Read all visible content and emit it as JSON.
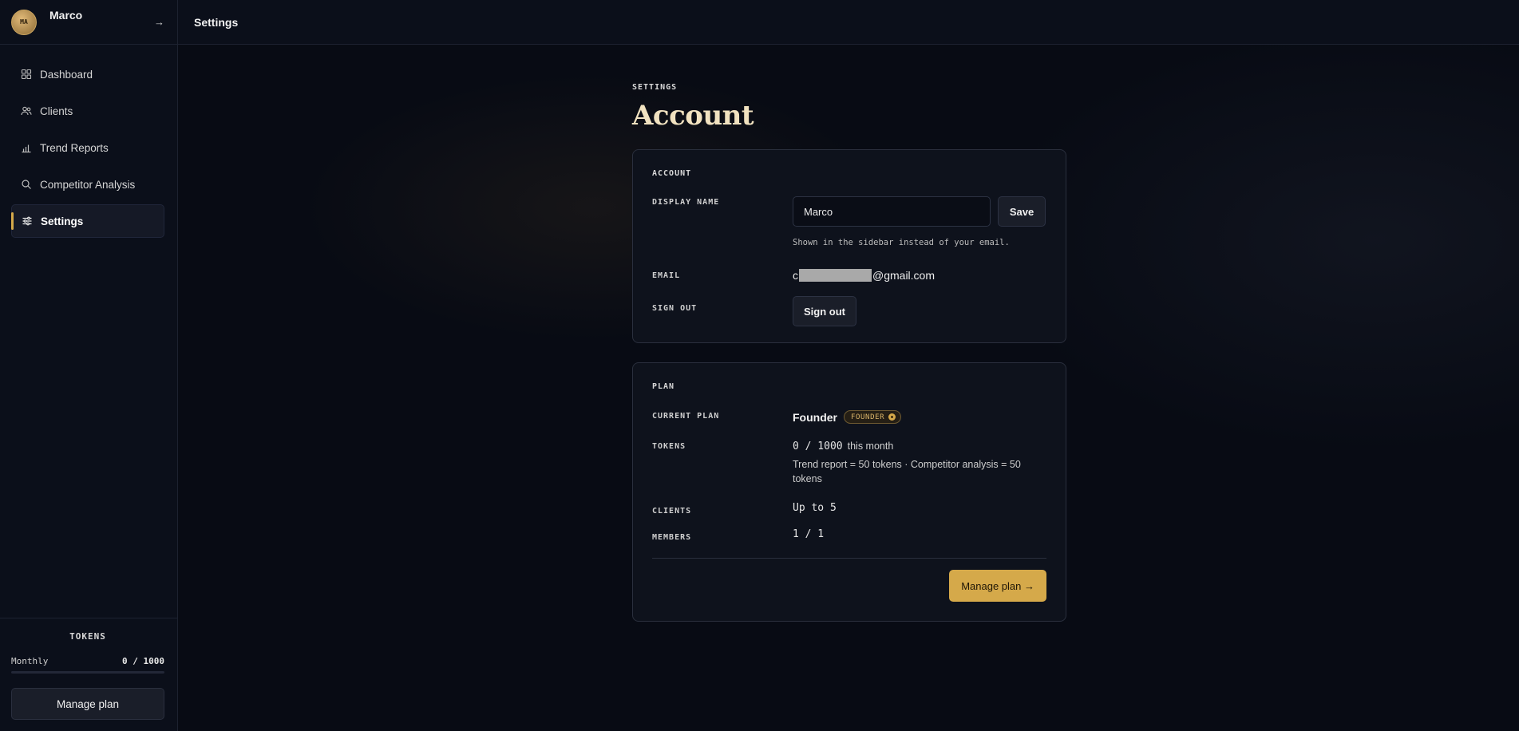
{
  "sidebar": {
    "avatar_initials": "MA",
    "user_name": "Marco",
    "collapse_icon": "→",
    "items": [
      {
        "label": "Dashboard",
        "icon": "grid-icon"
      },
      {
        "label": "Clients",
        "icon": "users-icon"
      },
      {
        "label": "Trend Reports",
        "icon": "bar-chart-icon"
      },
      {
        "label": "Competitor Analysis",
        "icon": "search-icon"
      },
      {
        "label": "Settings",
        "icon": "sliders-icon",
        "active": true
      }
    ],
    "tokens": {
      "title": "TOKENS",
      "period_label": "Monthly",
      "usage": "0 / 1000",
      "fill_fraction": 0
    },
    "manage_label": "Manage plan"
  },
  "topbar": {
    "title": "Settings"
  },
  "main": {
    "eyebrow": "SETTINGS",
    "title": "Account",
    "account_card": {
      "title": "ACCOUNT",
      "display_name_label": "DISPLAY NAME",
      "display_name_value": "Marco",
      "save_label": "Save",
      "hint": "Shown in the sidebar instead of your email.",
      "email_label": "EMAIL",
      "email_prefix": "c",
      "email_suffix": "@gmail.com",
      "sign_out_label": "SIGN OUT",
      "sign_out_button": "Sign out"
    },
    "plan_card": {
      "title": "PLAN",
      "current_plan_label": "CURRENT PLAN",
      "current_plan_value": "Founder",
      "badge": "FOUNDER",
      "tokens_label": "TOKENS",
      "tokens_value": "0 / 1000",
      "tokens_unit": "this month",
      "tokens_desc": "Trend report = 50 tokens · Competitor analysis = 50 tokens",
      "clients_label": "CLIENTS",
      "clients_value": "Up to 5",
      "members_label": "MEMBERS",
      "members_value": "1 / 1",
      "manage_button": "Manage plan →"
    }
  },
  "colors": {
    "accent": "#d5a94a",
    "background": "#080b14",
    "title": "#f1e2c0"
  }
}
